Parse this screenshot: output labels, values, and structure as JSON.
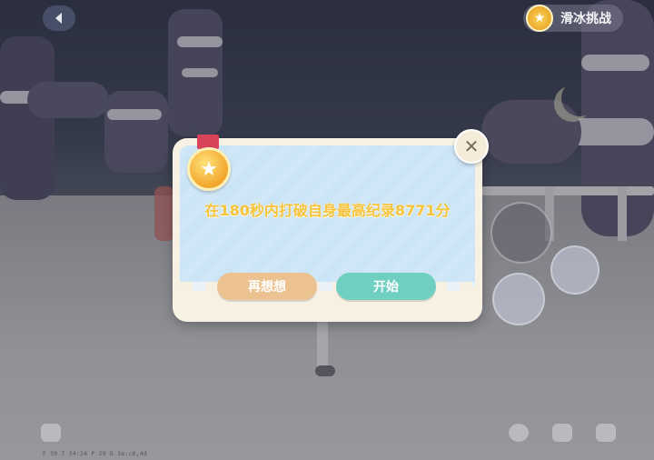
{
  "hud": {
    "back_icon": "chevron-left-icon",
    "challenge_label": "滑冰挑战",
    "challenge_icon": "medal-star-icon",
    "debug_text": "F 30   T 34:24   P 29   D  1m:c8,4d"
  },
  "dialog": {
    "medal_icon": "star-medal-icon",
    "message": "在180秒内打破自身最高纪录8771分",
    "cancel_label": "再想想",
    "start_label": "开始",
    "close_glyph": "✕",
    "colors": {
      "message": "#f5c33c",
      "cancel_button": "#edc291",
      "start_button": "#6fd0c2",
      "panel": "#cfe6f7"
    }
  }
}
